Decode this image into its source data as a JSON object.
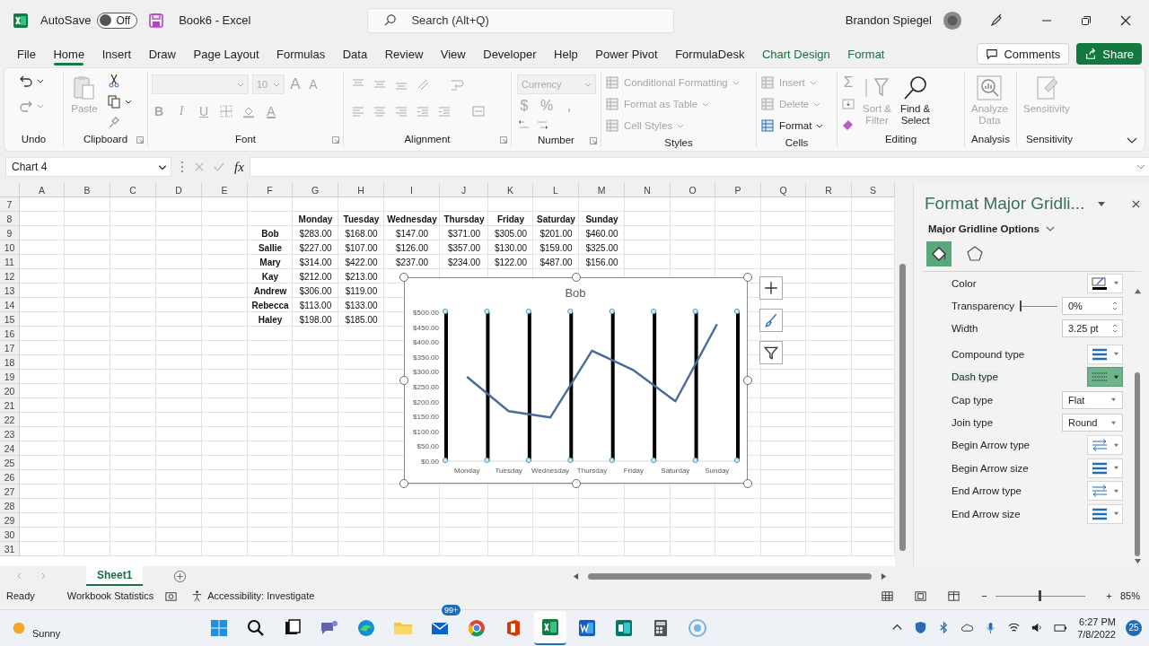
{
  "window": {
    "title": "Book6  -  Excel",
    "autosave": {
      "label": "AutoSave",
      "on": false,
      "state_text": "Off"
    },
    "search": {
      "placeholder": "Search (Alt+Q)"
    },
    "user": "Brandon Spiegel"
  },
  "tabs": [
    {
      "label": "File",
      "selected": false,
      "kind": "normal"
    },
    {
      "label": "Home",
      "selected": true,
      "kind": "normal"
    },
    {
      "label": "Insert",
      "selected": false,
      "kind": "normal"
    },
    {
      "label": "Draw",
      "selected": false,
      "kind": "normal"
    },
    {
      "label": "Page Layout",
      "selected": false,
      "kind": "normal"
    },
    {
      "label": "Formulas",
      "selected": false,
      "kind": "normal"
    },
    {
      "label": "Data",
      "selected": false,
      "kind": "normal"
    },
    {
      "label": "Review",
      "selected": false,
      "kind": "normal"
    },
    {
      "label": "View",
      "selected": false,
      "kind": "normal"
    },
    {
      "label": "Developer",
      "selected": false,
      "kind": "normal"
    },
    {
      "label": "Help",
      "selected": false,
      "kind": "normal"
    },
    {
      "label": "Power Pivot",
      "selected": false,
      "kind": "normal"
    },
    {
      "label": "FormulaDesk",
      "selected": false,
      "kind": "normal"
    },
    {
      "label": "Chart Design",
      "selected": false,
      "kind": "contextual"
    },
    {
      "label": "Format",
      "selected": false,
      "kind": "contextual"
    }
  ],
  "actions": {
    "comments": "Comments",
    "share": "Share"
  },
  "ribbon": {
    "groups": [
      {
        "label": "Undo"
      },
      {
        "label": "Clipboard",
        "items": [
          {
            "label": "Paste",
            "disabled": true
          }
        ]
      },
      {
        "label": "Font",
        "font_size": "10",
        "grow": "A",
        "shrink": "A",
        "buttons": [
          "B",
          "I",
          "U"
        ],
        "color_glyph": "A"
      },
      {
        "label": "Alignment"
      },
      {
        "label": "Number",
        "format": "Currency",
        "symbols": [
          "$",
          "%",
          ","
        ]
      },
      {
        "label": "Styles",
        "items": [
          {
            "label": "Conditional Formatting",
            "disabled": true
          },
          {
            "label": "Format as Table",
            "disabled": true
          },
          {
            "label": "Cell Styles",
            "disabled": true
          }
        ]
      },
      {
        "label": "Cells",
        "items": [
          {
            "label": "Insert",
            "disabled": true
          },
          {
            "label": "Delete",
            "disabled": true
          },
          {
            "label": "Format",
            "disabled": false
          }
        ]
      },
      {
        "label": "Editing",
        "sum": "Σ",
        "items": [
          {
            "label": "Sort &",
            "label2": "Filter",
            "disabled": true
          },
          {
            "label": "Find &",
            "label2": "Select",
            "disabled": false
          }
        ]
      },
      {
        "label": "Analysis",
        "items": [
          {
            "label": "Analyze",
            "label2": "Data",
            "disabled": true
          }
        ]
      },
      {
        "label": "Sensitivity",
        "items": [
          {
            "label": "Sensitivity",
            "disabled": true
          }
        ]
      }
    ]
  },
  "formula_bar": {
    "name_box": "Chart 4",
    "fx": "fx"
  },
  "sheet": {
    "columns": [
      "A",
      "B",
      "C",
      "D",
      "E",
      "F",
      "G",
      "H",
      "I",
      "J",
      "K",
      "L",
      "M",
      "N",
      "O",
      "P",
      "Q",
      "R",
      "S"
    ],
    "rows": [
      "7",
      "8",
      "9",
      "10",
      "11",
      "12",
      "13",
      "14",
      "15",
      "16",
      "17",
      "18",
      "19",
      "20",
      "21",
      "22",
      "23",
      "24",
      "25",
      "26",
      "27",
      "28",
      "29",
      "30",
      "31"
    ],
    "table": {
      "header": [
        "Monday",
        "Tuesday",
        "Wednesday",
        "Thursday",
        "Friday",
        "Saturday",
        "Sunday"
      ],
      "rows": [
        {
          "name": "Bob",
          "values": [
            "$283.00",
            "$168.00",
            "$147.00",
            "$371.00",
            "$305.00",
            "$201.00",
            "$460.00"
          ]
        },
        {
          "name": "Sallie",
          "values": [
            "$227.00",
            "$107.00",
            "$126.00",
            "$357.00",
            "$130.00",
            "$159.00",
            "$325.00"
          ]
        },
        {
          "name": "Mary",
          "values": [
            "$314.00",
            "$422.00",
            "$237.00",
            "$234.00",
            "$122.00",
            "$487.00",
            "$156.00"
          ]
        },
        {
          "name": "Kay",
          "values": [
            "$212.00",
            "$213.00"
          ]
        },
        {
          "name": "Andrew",
          "values": [
            "$306.00",
            "$119.00"
          ]
        },
        {
          "name": "Rebecca",
          "values": [
            "$113.00",
            "$133.00"
          ]
        },
        {
          "name": "Haley",
          "values": [
            "$198.00",
            "$185.00"
          ]
        }
      ]
    },
    "chart_data": {
      "type": "line",
      "title": "Bob",
      "categories": [
        "Monday",
        "Tuesday",
        "Wednesday",
        "Thursday",
        "Friday",
        "Saturday",
        "Sunday"
      ],
      "series": [
        {
          "color": "#4a6a9b",
          "values": [
            283,
            168,
            147,
            371,
            305,
            201,
            460
          ]
        }
      ],
      "ylim": [
        0,
        500
      ],
      "yticks": [
        {
          "value": 0,
          "label": "$0.00"
        },
        {
          "value": 50,
          "label": "$50.00"
        },
        {
          "value": 100,
          "label": "$100.00"
        },
        {
          "value": 150,
          "label": "$150.00"
        },
        {
          "value": 200,
          "label": "$200.00"
        },
        {
          "value": 250,
          "label": "$250.00"
        },
        {
          "value": 300,
          "label": "$300.00"
        },
        {
          "value": 350,
          "label": "$350.00"
        },
        {
          "value": 400,
          "label": "$400.00"
        },
        {
          "value": 450,
          "label": "$450.00"
        },
        {
          "value": 500,
          "label": "$500.00"
        }
      ]
    }
  },
  "format_pane": {
    "title": "Format Major Gridli...",
    "section": "Major Gridline Options",
    "icon_tabs": [
      {
        "selected": true
      },
      {
        "selected": false
      }
    ],
    "properties": [
      {
        "label": "Color",
        "kind": "color",
        "highlighted": false
      },
      {
        "label": "Transparency",
        "kind": "slider",
        "value": "0%",
        "level": 0,
        "highlighted": false
      },
      {
        "label": "Width",
        "kind": "spin",
        "value": "3.25 pt",
        "highlighted": false
      },
      {
        "label": "Compound type",
        "kind": "lines",
        "highlighted": false
      },
      {
        "label": "Dash type",
        "kind": "dashes",
        "highlighted": true
      },
      {
        "label": "Cap type",
        "kind": "dropdown",
        "value": "Flat",
        "highlighted": false
      },
      {
        "label": "Join type",
        "kind": "dropdown",
        "value": "Round",
        "highlighted": false
      },
      {
        "label": "Begin Arrow type",
        "kind": "arrows",
        "highlighted": false
      },
      {
        "label": "Begin Arrow size",
        "kind": "lines",
        "highlighted": false
      },
      {
        "label": "End Arrow type",
        "kind": "arrows",
        "highlighted": false
      },
      {
        "label": "End Arrow size",
        "kind": "lines",
        "highlighted": false
      }
    ]
  },
  "sheet_tabs": [
    {
      "label": "Sheet1",
      "selected": true
    }
  ],
  "status_bar": {
    "items": [
      "Ready",
      "Workbook Statistics",
      "Accessibility: Investigate"
    ],
    "zoom": "85%",
    "zoom_slider": {
      "level": 0.5
    }
  },
  "taskbar": {
    "weather": "Sunny",
    "store_badge": "99+",
    "time": "6:27 PM",
    "date": "7/8/2022",
    "notifications": "25"
  }
}
